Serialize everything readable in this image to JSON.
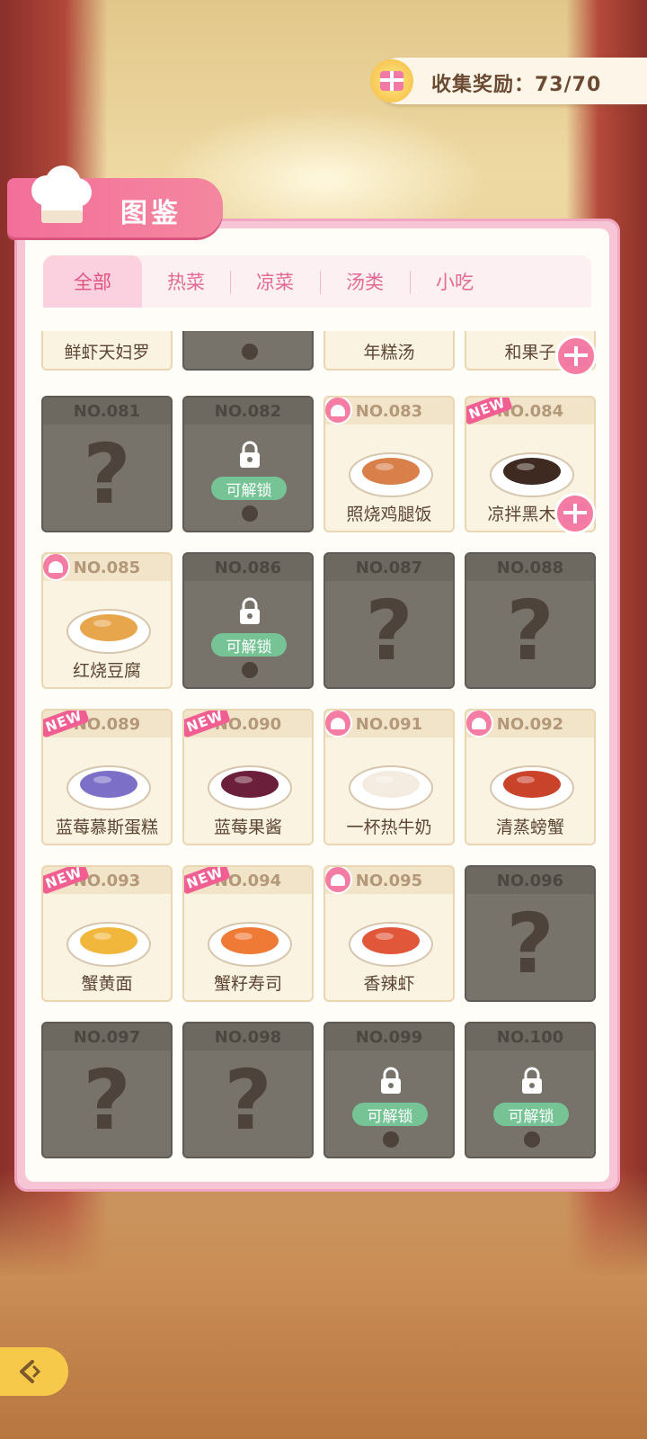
{
  "reward": {
    "label": "收集奖励：73/70",
    "icon": "gift-icon"
  },
  "title": "图鉴",
  "tabs": [
    "全部",
    "热菜",
    "凉菜",
    "汤类",
    "小吃"
  ],
  "active_tab": "全部",
  "top_row": [
    {
      "name": "鲜虾天妇罗",
      "state": "open"
    },
    {
      "name": "",
      "state": "locked"
    },
    {
      "name": "年糕汤",
      "state": "open"
    },
    {
      "name": "和果子",
      "state": "open",
      "gift": true
    }
  ],
  "cards": [
    {
      "no": "NO.081",
      "state": "unknown"
    },
    {
      "no": "NO.082",
      "state": "unlockable",
      "unlock_label": "可解锁"
    },
    {
      "no": "NO.083",
      "state": "open",
      "name": "照烧鸡腿饭",
      "badge": "hat",
      "dish_color": "#d9804a"
    },
    {
      "no": "NO.084",
      "state": "open",
      "name": "凉拌黑木耳",
      "badge": "new",
      "gift": true,
      "dish_color": "#3f2a22"
    },
    {
      "no": "NO.085",
      "state": "open",
      "name": "红烧豆腐",
      "badge": "hat",
      "dish_color": "#e7a64c"
    },
    {
      "no": "NO.086",
      "state": "unlockable",
      "unlock_label": "可解锁"
    },
    {
      "no": "NO.087",
      "state": "unknown"
    },
    {
      "no": "NO.088",
      "state": "unknown"
    },
    {
      "no": "NO.089",
      "state": "open",
      "name": "蓝莓慕斯蛋糕",
      "badge": "new",
      "dish_color": "#7c6fc8"
    },
    {
      "no": "NO.090",
      "state": "open",
      "name": "蓝莓果酱",
      "badge": "new",
      "dish_color": "#6b1f3a"
    },
    {
      "no": "NO.091",
      "state": "open",
      "name": "一杯热牛奶",
      "badge": "hat",
      "dish_color": "#f4ece1"
    },
    {
      "no": "NO.092",
      "state": "open",
      "name": "清蒸螃蟹",
      "badge": "hat",
      "dish_color": "#c9432b"
    },
    {
      "no": "NO.093",
      "state": "open",
      "name": "蟹黄面",
      "badge": "new",
      "dish_color": "#f0b73c"
    },
    {
      "no": "NO.094",
      "state": "open",
      "name": "蟹籽寿司",
      "badge": "new",
      "dish_color": "#ee7a35"
    },
    {
      "no": "NO.095",
      "state": "open",
      "name": "香辣虾",
      "badge": "hat",
      "dish_color": "#e0573a"
    },
    {
      "no": "NO.096",
      "state": "unknown"
    },
    {
      "no": "NO.097",
      "state": "unknown"
    },
    {
      "no": "NO.098",
      "state": "unknown"
    },
    {
      "no": "NO.099",
      "state": "unlockable",
      "unlock_label": "可解锁"
    },
    {
      "no": "NO.100",
      "state": "unlockable",
      "unlock_label": "可解锁"
    }
  ],
  "back_button": {
    "icon": "back-arrow-icon"
  },
  "colors": {
    "accent": "#f36f9a",
    "unlock": "#76c495",
    "locked_card": "#77726a"
  }
}
